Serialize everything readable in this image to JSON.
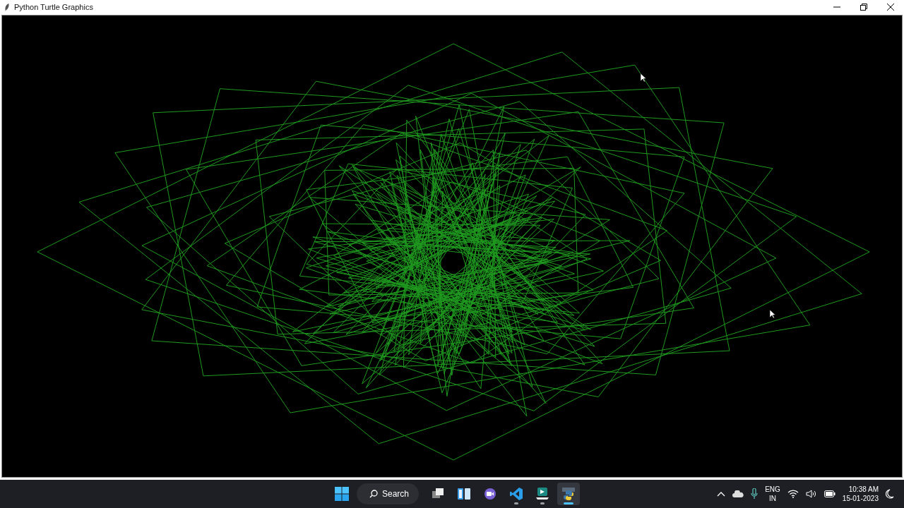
{
  "window": {
    "title": "Python Turtle Graphics"
  },
  "taskbar": {
    "search": {
      "label": "Search"
    },
    "apps": [
      {
        "kind": "task-view",
        "running": false,
        "selected": false
      },
      {
        "kind": "widgets",
        "running": false,
        "selected": false
      },
      {
        "kind": "chat",
        "running": false,
        "selected": false
      },
      {
        "kind": "code-editor",
        "running": true,
        "selected": false
      },
      {
        "kind": "media-app",
        "running": true,
        "selected": false
      },
      {
        "kind": "python",
        "running": true,
        "selected": true
      }
    ],
    "tray": {
      "language": "ENG",
      "region": "IN",
      "time": "10:38 AM",
      "date": "15-01-2023"
    }
  }
}
